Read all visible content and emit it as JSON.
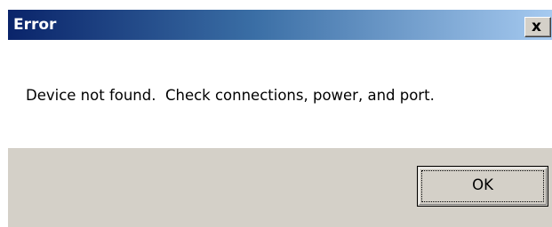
{
  "dialog": {
    "title": "Error",
    "close_glyph": "x",
    "message": "Device not found.  Check connections, power, and port.",
    "ok_label": "OK"
  },
  "icons": {
    "close": "close-icon"
  },
  "colors": {
    "titlebar_start": "#0a246a",
    "titlebar_end": "#a6caf0",
    "title_text": "#ffffff",
    "dialog_face": "#d4d0c8",
    "message_background": "#ffffff"
  }
}
